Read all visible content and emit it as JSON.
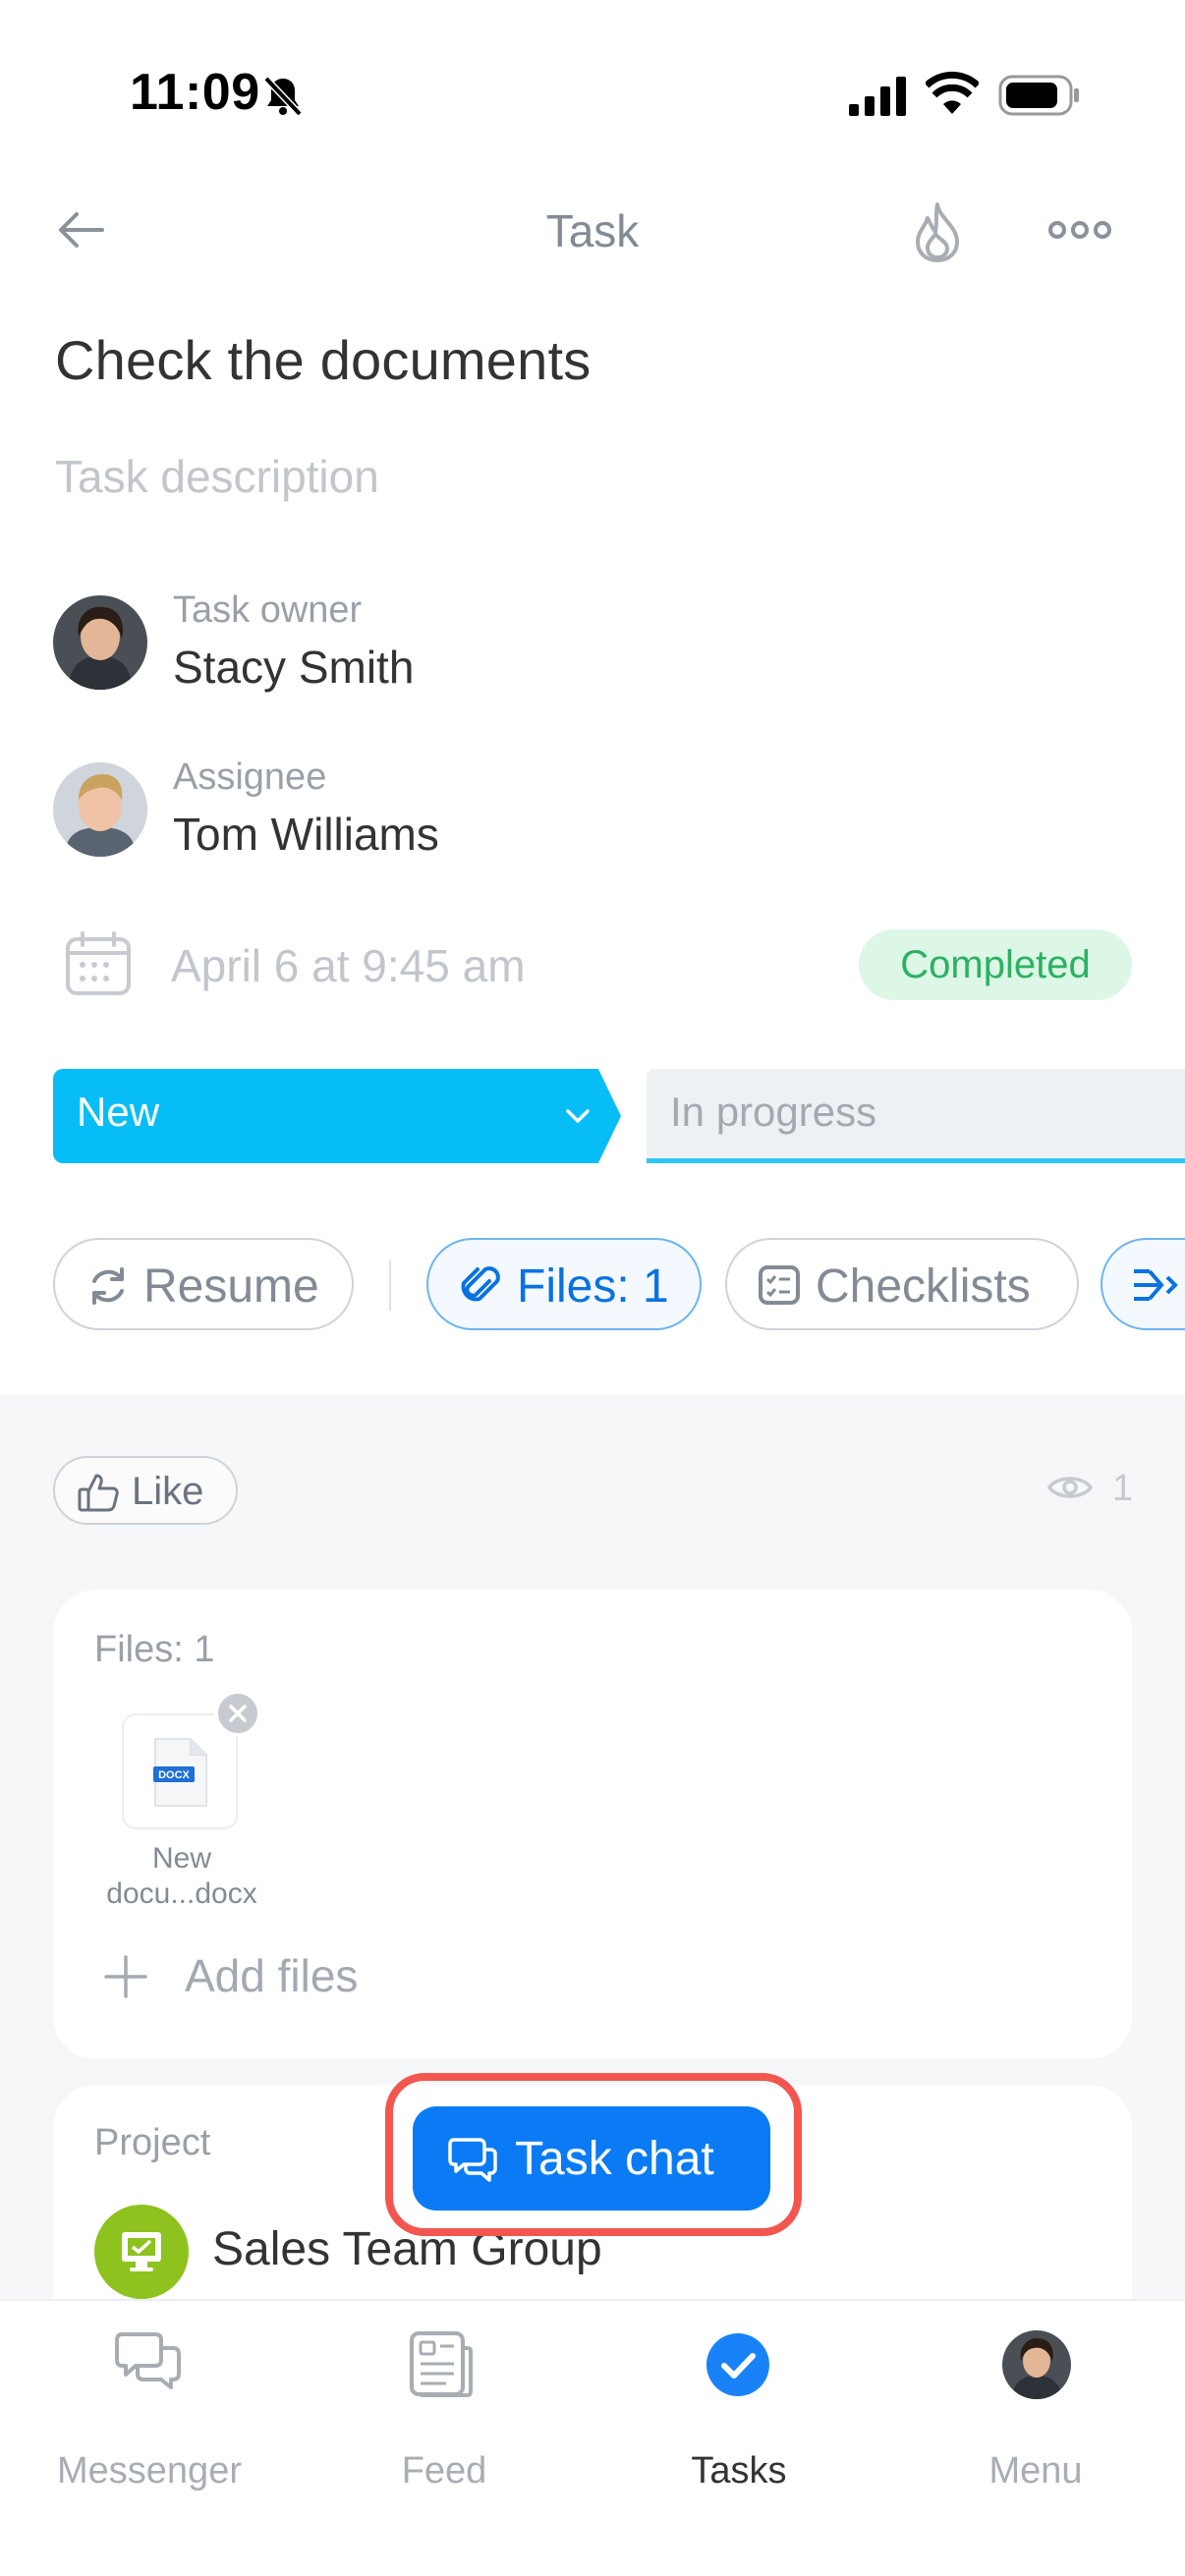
{
  "status_bar": {
    "time": "11:09"
  },
  "header": {
    "title": "Task"
  },
  "task": {
    "title": "Check the documents",
    "description_placeholder": "Task description",
    "owner": {
      "role": "Task owner",
      "name": "Stacy Smith"
    },
    "assignee": {
      "role": "Assignee",
      "name": "Tom Williams"
    },
    "deadline": "April 6 at 9:45 am",
    "status": "Completed"
  },
  "stages": [
    {
      "label": "New",
      "active": true
    },
    {
      "label": "In progress",
      "active": false
    }
  ],
  "actions": {
    "resume": "Resume",
    "files": "Files: 1",
    "checklists": "Checklists"
  },
  "social": {
    "like": "Like",
    "views": "1"
  },
  "files_card": {
    "label": "Files: 1",
    "file_badge": "DOCX",
    "file_name_line1": "New",
    "file_name_line2": "docu...docx",
    "add_files": "Add files"
  },
  "project_card": {
    "label": "Project",
    "name": "Sales Team Group"
  },
  "chat_button": {
    "label": "Task chat"
  },
  "bottom_nav": [
    {
      "label": "Messenger",
      "icon": "messenger-icon"
    },
    {
      "label": "Feed",
      "icon": "feed-icon"
    },
    {
      "label": "Tasks",
      "icon": "tasks-check-icon",
      "active": true
    },
    {
      "label": "Menu",
      "icon": "avatar"
    }
  ],
  "colors": {
    "accent": "#0a7bf5",
    "stage_new": "#06bdf6",
    "completed_bg": "#dcf7e6",
    "completed_text": "#2bb161",
    "highlight": "#f2564f",
    "project": "#8dc21f"
  }
}
